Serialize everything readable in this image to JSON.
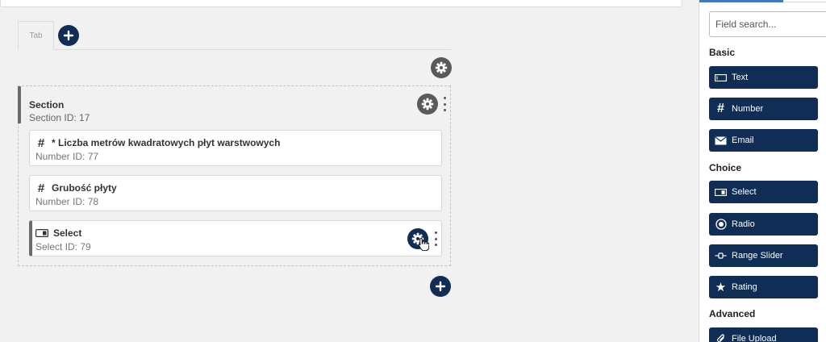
{
  "canvas": {
    "tabs": [
      {
        "label": "Tab"
      }
    ],
    "section": {
      "title": "Section",
      "id_label": "Section ID:",
      "id_value": "17",
      "fields": [
        {
          "icon": "hash-icon",
          "title": "* Liczba metrów kwadratowych płyt warstwowych",
          "id_label": "Number ID:",
          "id_value": "77"
        },
        {
          "icon": "hash-icon",
          "title": "Grubość płyty",
          "id_label": "Number ID:",
          "id_value": "78"
        },
        {
          "icon": "select-icon",
          "title": "Select",
          "id_label": "Select ID:",
          "id_value": "79"
        }
      ]
    }
  },
  "sidebar": {
    "search": {
      "placeholder": "Field search..."
    },
    "groups": [
      {
        "label": "Basic",
        "items": [
          {
            "label": "Text",
            "icon": "text-field-icon"
          },
          {
            "label": "Number",
            "icon": "hash-icon"
          },
          {
            "label": "Email",
            "icon": "envelope-icon"
          }
        ]
      },
      {
        "label": "Choice",
        "items": [
          {
            "label": "Select",
            "icon": "select-icon"
          },
          {
            "label": "Radio",
            "icon": "radio-icon"
          },
          {
            "label": "Range Slider",
            "icon": "slider-icon"
          },
          {
            "label": "Rating",
            "icon": "star-icon"
          }
        ]
      },
      {
        "label": "Advanced",
        "items": [
          {
            "label": "File Upload",
            "icon": "paperclip-icon"
          }
        ]
      }
    ]
  },
  "colors": {
    "primary": "#0f2d55",
    "gear": "#5a5a5a",
    "accent": "#4178be"
  }
}
